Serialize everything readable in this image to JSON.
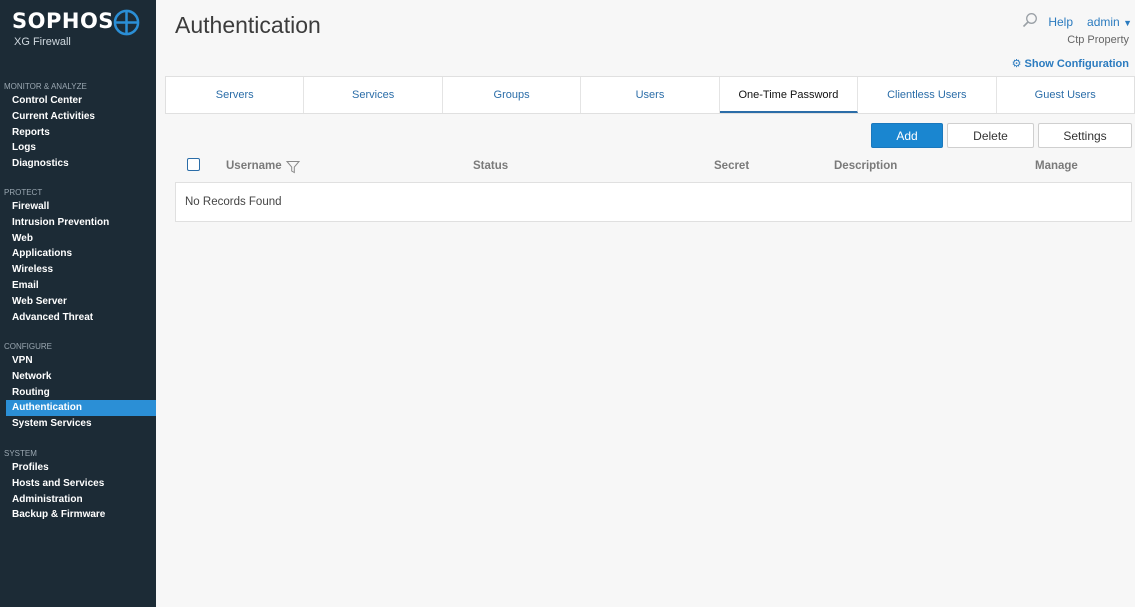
{
  "brand": {
    "name": "SOPHOS",
    "product": "XG Firewall"
  },
  "sidebar": {
    "sections": [
      {
        "title": "MONITOR & ANALYZE",
        "items": [
          "Control Center",
          "Current Activities",
          "Reports",
          "Logs",
          "Diagnostics"
        ]
      },
      {
        "title": "PROTECT",
        "items": [
          "Firewall",
          "Intrusion Prevention",
          "Web",
          "Applications",
          "Wireless",
          "Email",
          "Web Server",
          "Advanced Threat"
        ]
      },
      {
        "title": "CONFIGURE",
        "items": [
          "VPN",
          "Network",
          "Routing",
          "Authentication",
          "System Services"
        ]
      },
      {
        "title": "SYSTEM",
        "items": [
          "Profiles",
          "Hosts and Services",
          "Administration",
          "Backup & Firmware"
        ]
      }
    ],
    "active_item": "Authentication"
  },
  "header": {
    "title": "Authentication",
    "help_label": "Help",
    "user_label": "admin",
    "property_label": "Ctp Property",
    "show_config_label": "Show Configuration"
  },
  "tabs": [
    {
      "label": "Servers",
      "active": false
    },
    {
      "label": "Services",
      "active": false
    },
    {
      "label": "Groups",
      "active": false
    },
    {
      "label": "Users",
      "active": false
    },
    {
      "label": "One-Time Password",
      "active": true
    },
    {
      "label": "Clientless Users",
      "active": false
    },
    {
      "label": "Guest Users",
      "active": false
    }
  ],
  "toolbar": {
    "add_label": "Add",
    "delete_label": "Delete",
    "settings_label": "Settings"
  },
  "table": {
    "columns": [
      "Username",
      "Status",
      "Secret",
      "Description",
      "Manage"
    ],
    "empty_message": "No Records Found"
  },
  "colors": {
    "sidebar_bg": "#1c2b36",
    "accent": "#1a86d0",
    "link": "#2b7bbf",
    "active_nav": "#2b8fd6"
  }
}
